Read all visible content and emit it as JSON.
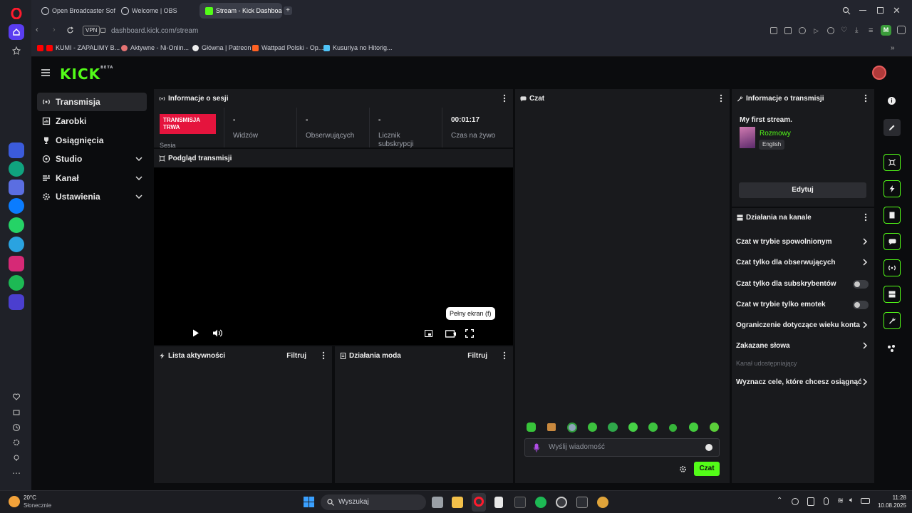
{
  "browser": {
    "tabs": [
      {
        "label": "Open Broadcaster Softw..."
      },
      {
        "label": "Welcome | OBS"
      },
      {
        "label": "Stream - Kick Dashboard"
      }
    ],
    "vpn_label": "VPN",
    "url": "dashboard.kick.com/stream",
    "profile_initial": "M",
    "bookmarks": [
      "KUMI - ZAPALIMY B...",
      "Aktywne - Ni-Onlin...",
      "Główna | Patreon",
      "Wattpad Polski - Op...",
      "Kusuriya no Hitorig..."
    ]
  },
  "kick": {
    "logo": "KICK",
    "logo_badge": "BETA",
    "nav": [
      {
        "label": "Transmisja",
        "active": true
      },
      {
        "label": "Zarobki"
      },
      {
        "label": "Osiągnięcia"
      },
      {
        "label": "Studio",
        "expandable": true
      },
      {
        "label": "Kanał",
        "expandable": true
      },
      {
        "label": "Ustawienia",
        "expandable": true
      }
    ],
    "session": {
      "title": "Informacje o sesji",
      "live_badge": "TRANSMISJA TRWA",
      "session_label": "Sesja",
      "stats": [
        {
          "value": "-",
          "label": "Widzów"
        },
        {
          "value": "-",
          "label": "Obserwujących"
        },
        {
          "value": "-",
          "label": "Licznik subskrypcji"
        },
        {
          "value": "00:01:17",
          "label": "Czas na żywo"
        }
      ]
    },
    "preview": {
      "title": "Podgląd transmisji",
      "tooltip": "Pełny ekran (f)"
    },
    "activity": {
      "title": "Lista aktywności",
      "filter": "Filtruj"
    },
    "mod": {
      "title": "Działania moda",
      "filter": "Filtruj"
    },
    "chat": {
      "title": "Czat",
      "placeholder": "Wyślij wiadomość",
      "send": "Czat"
    },
    "stream_info": {
      "title": "Informacje o transmisji",
      "stream_title": "My first stream.",
      "category": "Rozmowy",
      "language": "English",
      "edit": "Edytuj"
    },
    "channel_actions": {
      "title": "Działania na kanale",
      "items": [
        {
          "label": "Czat w trybie spowolnionym",
          "kind": "arrow"
        },
        {
          "label": "Czat tylko dla obserwujących",
          "kind": "arrow"
        },
        {
          "label": "Czat tylko dla subskrybentów",
          "kind": "toggle"
        },
        {
          "label": "Czat w trybie tylko emotek",
          "kind": "toggle"
        },
        {
          "label": "Ograniczenie dotyczące wieku konta",
          "kind": "arrow"
        },
        {
          "label": "Zakazane słowa",
          "kind": "arrow"
        },
        {
          "label": "Kanał udostępniający",
          "kind": "muted"
        },
        {
          "label": "Wyznacz cele, które chcesz osiągnąć",
          "kind": "arrow"
        }
      ]
    }
  },
  "taskbar": {
    "weather_temp": "20°C",
    "weather_desc": "Słonecznie",
    "search": "Wyszukaj",
    "time": "11:28",
    "date": "10.08.2025"
  },
  "colors": {
    "accent": "#53fc18",
    "live": "#e5143d",
    "opera": "#ff1b2d"
  }
}
